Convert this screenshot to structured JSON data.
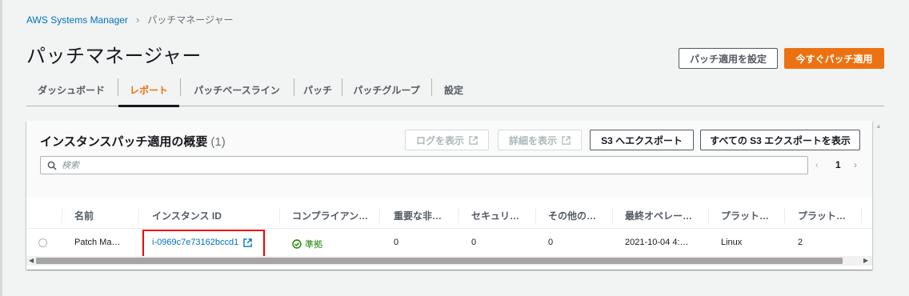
{
  "breadcrumb": {
    "root": "AWS Systems Manager",
    "current": "パッチマネージャー"
  },
  "page": {
    "title": "パッチマネージャー"
  },
  "header_buttons": {
    "configure": "パッチ適用を設定",
    "patch_now": "今すぐパッチ適用"
  },
  "tabs": [
    {
      "label": "ダッシュボード",
      "active": false
    },
    {
      "label": "レポート",
      "active": true
    },
    {
      "label": "パッチベースライン",
      "active": false
    },
    {
      "label": "パッチ",
      "active": false
    },
    {
      "label": "パッチグループ",
      "active": false
    },
    {
      "label": "設定",
      "active": false
    }
  ],
  "panel": {
    "title": "インスタンスパッチ適用の概要",
    "count": "(1)",
    "buttons": {
      "view_logs": "ログを表示",
      "view_details": "詳細を表示",
      "export_s3": "S3 へエクスポート",
      "view_all_exports": "すべての S3 エクスポートを表示"
    },
    "search_placeholder": "検索",
    "pager": {
      "prev": "‹",
      "page": "1",
      "next": "›"
    }
  },
  "table": {
    "columns": [
      "名前",
      "インスタンス ID",
      "コンプライアン…",
      "重要な非…",
      "セキュリ…",
      "その他の…",
      "最終オペレー…",
      "プラット…",
      "プラット…"
    ],
    "rows": [
      {
        "name": "Patch Ma…",
        "instance_id": "i-0969c7e73162bccd1",
        "compliance": "準拠",
        "critical_noncompliant": "0",
        "security": "0",
        "other": "0",
        "last_operation": "2021-10-04 4:…",
        "platform": "Linux",
        "platform2": "2"
      }
    ]
  },
  "colors": {
    "accent": "#ec7211",
    "link": "#0073bb",
    "success": "#1d8102",
    "highlight": "#e00000"
  }
}
